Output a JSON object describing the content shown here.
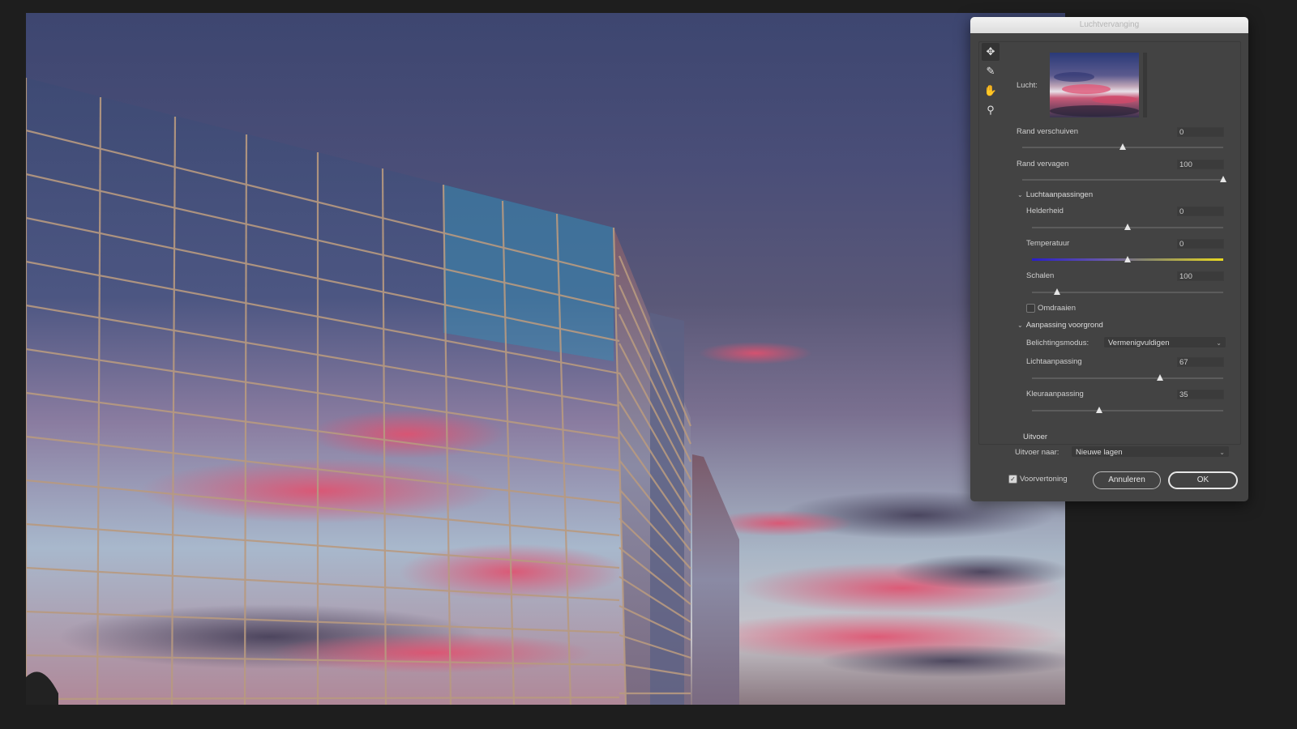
{
  "dialog": {
    "title": "Luchtvervanging",
    "tools": [
      "move-icon",
      "brush-icon",
      "hand-icon",
      "zoom-icon"
    ],
    "sky_label": "Lucht:",
    "sliders": {
      "shift_edge": {
        "label": "Rand verschuiven",
        "value": "0",
        "fraction": 0.5
      },
      "fade_edge": {
        "label": "Rand vervagen",
        "value": "100",
        "fraction": 1.0
      },
      "brightness": {
        "label": "Helderheid",
        "value": "0",
        "fraction": 0.5
      },
      "temperature": {
        "label": "Temperatuur",
        "value": "0",
        "fraction": 0.5
      },
      "scale": {
        "label": "Schalen",
        "value": "100",
        "fraction": 0.13
      },
      "lighting": {
        "label": "Lichtaanpassing",
        "value": "67",
        "fraction": 0.67
      },
      "color_adjust": {
        "label": "Kleuraanpassing",
        "value": "35",
        "fraction": 0.35
      }
    },
    "sky_adjustments_heading": "Luchtaanpassingen",
    "flip_label": "Omdraaien",
    "foreground_heading": "Aanpassing voorgrond",
    "blend_mode_label": "Belichtingsmodus:",
    "blend_mode_value": "Vermenigvuldigen",
    "output_heading": "Uitvoer",
    "output_to_label": "Uitvoer naar:",
    "output_to_value": "Nieuwe lagen",
    "preview_label": "Voorvertoning",
    "preview_checked": true,
    "cancel_label": "Annuleren",
    "ok_label": "OK"
  }
}
